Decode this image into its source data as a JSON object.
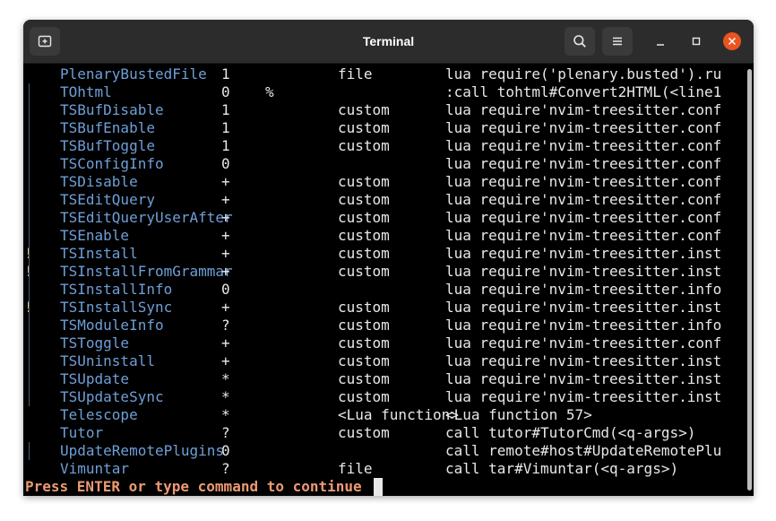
{
  "window": {
    "title": "Terminal",
    "icons": {
      "new_tab": "new-tab-icon",
      "search": "search-icon",
      "menu": "hamburger-menu-icon",
      "minimize": "minimize-icon",
      "maximize": "maximize-icon",
      "close": "close-icon"
    }
  },
  "terminal": {
    "rows": [
      {
        "flag": "",
        "bar": false,
        "name": "PlenaryBustedFile",
        "nargs": "1",
        "range": "",
        "complete": "file",
        "definition": "lua require('plenary.busted').ru"
      },
      {
        "flag": "",
        "bar": true,
        "name": "TOhtml",
        "nargs": "0",
        "range": "%",
        "complete": "",
        "definition": ":call tohtml#Convert2HTML(<line1"
      },
      {
        "flag": "",
        "bar": true,
        "name": "TSBufDisable",
        "nargs": "1",
        "range": "",
        "complete": "custom",
        "definition": "lua require'nvim-treesitter.conf"
      },
      {
        "flag": "",
        "bar": true,
        "name": "TSBufEnable",
        "nargs": "1",
        "range": "",
        "complete": "custom",
        "definition": "lua require'nvim-treesitter.conf"
      },
      {
        "flag": "",
        "bar": true,
        "name": "TSBufToggle",
        "nargs": "1",
        "range": "",
        "complete": "custom",
        "definition": "lua require'nvim-treesitter.conf"
      },
      {
        "flag": "",
        "bar": true,
        "name": "TSConfigInfo",
        "nargs": "0",
        "range": "",
        "complete": "",
        "definition": "lua require'nvim-treesitter.conf"
      },
      {
        "flag": "",
        "bar": true,
        "name": "TSDisable",
        "nargs": "+",
        "range": "",
        "complete": "custom",
        "definition": "lua require'nvim-treesitter.conf"
      },
      {
        "flag": "",
        "bar": true,
        "name": "TSEditQuery",
        "nargs": "+",
        "range": "",
        "complete": "custom",
        "definition": "lua require'nvim-treesitter.conf"
      },
      {
        "flag": "",
        "bar": true,
        "name": "TSEditQueryUserAfter",
        "nargs": "+",
        "range": "",
        "complete": "custom",
        "definition": "lua require'nvim-treesitter.conf"
      },
      {
        "flag": "",
        "bar": true,
        "name": "TSEnable",
        "nargs": "+",
        "range": "",
        "complete": "custom",
        "definition": "lua require'nvim-treesitter.conf"
      },
      {
        "flag": "!",
        "bar": true,
        "name": "TSInstall",
        "nargs": "+",
        "range": "",
        "complete": "custom",
        "definition": "lua require'nvim-treesitter.inst"
      },
      {
        "flag": "!",
        "bar": true,
        "name": "TSInstallFromGrammar",
        "nargs": "+",
        "range": "",
        "complete": "custom",
        "definition": "lua require'nvim-treesitter.inst"
      },
      {
        "flag": "",
        "bar": true,
        "name": "TSInstallInfo",
        "nargs": "0",
        "range": "",
        "complete": "",
        "definition": "lua require'nvim-treesitter.info"
      },
      {
        "flag": "!",
        "bar": true,
        "name": "TSInstallSync",
        "nargs": "+",
        "range": "",
        "complete": "custom",
        "definition": "lua require'nvim-treesitter.inst"
      },
      {
        "flag": "",
        "bar": true,
        "name": "TSModuleInfo",
        "nargs": "?",
        "range": "",
        "complete": "custom",
        "definition": "lua require'nvim-treesitter.info"
      },
      {
        "flag": "",
        "bar": true,
        "name": "TSToggle",
        "nargs": "+",
        "range": "",
        "complete": "custom",
        "definition": "lua require'nvim-treesitter.conf"
      },
      {
        "flag": "",
        "bar": true,
        "name": "TSUninstall",
        "nargs": "+",
        "range": "",
        "complete": "custom",
        "definition": "lua require'nvim-treesitter.inst"
      },
      {
        "flag": "",
        "bar": true,
        "name": "TSUpdate",
        "nargs": "*",
        "range": "",
        "complete": "custom",
        "definition": "lua require'nvim-treesitter.inst"
      },
      {
        "flag": "",
        "bar": true,
        "name": "TSUpdateSync",
        "nargs": "*",
        "range": "",
        "complete": "custom",
        "definition": "lua require'nvim-treesitter.inst"
      },
      {
        "flag": "",
        "bar": false,
        "name": "Telescope",
        "nargs": "*",
        "range": "",
        "complete": "<Lua function>",
        "definition": "<Lua function 57>"
      },
      {
        "flag": "",
        "bar": false,
        "name": "Tutor",
        "nargs": "?",
        "range": "",
        "complete": "custom",
        "definition": "call tutor#TutorCmd(<q-args>)"
      },
      {
        "flag": "",
        "bar": true,
        "name": "UpdateRemotePlugins",
        "nargs": "0",
        "range": "",
        "complete": "",
        "definition": "call remote#host#UpdateRemotePlu"
      },
      {
        "flag": "",
        "bar": false,
        "name": "Vimuntar",
        "nargs": "?",
        "range": "",
        "complete": "file",
        "definition": "call tar#Vimuntar(<q-args>)"
      }
    ],
    "prompt": "Press ENTER or type command to continue"
  },
  "colors": {
    "background": "#000000",
    "titlebar": "#2c2c2c",
    "command_name": "#6f9fd8",
    "prompt": "#ec9a73",
    "close_button": "#e95420"
  }
}
